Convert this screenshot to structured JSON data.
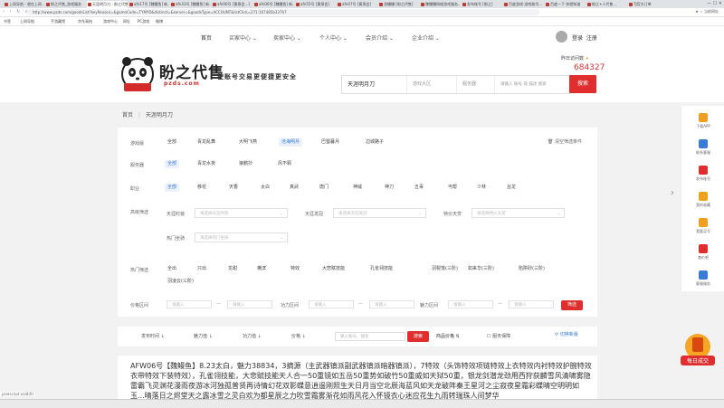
{
  "browser": {
    "tabs": [
      "上网导航 - 就在上网 ...",
      "盼之代售_游戏服务",
      "天涯明月刀 - 盼之代售",
      "afn17号 [魏鳗鱼] 新...",
      "afn33号 [魏鳗鱼] 新...",
      "afn06号 [黄泉会...]",
      "afn06号 [魏鳗鱼] 新...",
      "afn55号 [黄泉会]",
      "afn07号 [黄泉会]",
      "游鳗鳗 [盼之代售]",
      "魏鳗鳗网络游戏服务...",
      "发布账号 [盼之]",
      "百度游戏-游戏账号...",
      "百度一下 你就知道",
      "盼之+人代售...",
      "TJ官方订单"
    ],
    "url": "http://www.pzds.com/goodsList?keyReason=&gameCode=TYMYD&distinct=&server=&goodsType=ACCOUNT&listClick=271:167485b33767",
    "nav_controls": "‹ › ↻ ⌂",
    "address_right": "★ ☆ 当前网址",
    "bookmarks": [
      "书签",
      "上网导航",
      "手游藏馆",
      "京东高档",
      "游戏中心",
      "网址",
      "PC游戏",
      "微博"
    ]
  },
  "site_nav": {
    "items": [
      "首页",
      "买家中心",
      "卖家中心",
      "个人中心",
      "会员介绍",
      "企业介绍"
    ],
    "login": "登录",
    "register": "注册"
  },
  "header": {
    "logo_title": "盼之代售",
    "logo_domain": "pzds.com",
    "slogan": "使账号交易更便捷更安全",
    "visits_label": "昨日访问数",
    "visits_count": "684327",
    "search_game": "天涯明月刀",
    "search_type": "游戏大区",
    "search_server": "服务器",
    "search_placeholder": "请输入 账号 或 描述 搜索",
    "search_button": "搜索"
  },
  "breadcrumb": {
    "home": "首页",
    "sep": "|",
    "current": "天涯明月刀"
  },
  "filters": {
    "clear": "清空筛选条件",
    "game_type_label": "游戏版",
    "game_type": [
      "全部",
      "青龙乱舞",
      "大明飞燕",
      "沧海明月",
      "巴蜀暮月",
      "边城路子"
    ],
    "server_label": "服务器",
    "server": [
      "全部",
      "青龙水夜",
      "狼鹏抄",
      "风不羁"
    ],
    "class_label": "职业",
    "classes": [
      "全部",
      "移花",
      "天香",
      "太白",
      "真武",
      "唐门",
      "神威",
      "神刀",
      "五毒",
      "丐帮",
      "少林",
      "丛龙"
    ],
    "quick_label": "高级筛选",
    "selects": [
      {
        "label": "天涯时装",
        "placeholder": "请选择天涯时装"
      },
      {
        "label": "天涯发冠",
        "placeholder": "请选择天涯发冠"
      },
      {
        "label": "特价天赏",
        "placeholder": "请选择特价天赏"
      },
      {
        "label": "热门坐骑",
        "placeholder": "请选择热门坐骑"
      }
    ],
    "hot_label": "热门筛选",
    "hot_row1": [
      "全出",
      "只出",
      "龙甜",
      "横滨",
      "特效",
      "大悲赋技能",
      "孔雀翎技能",
      "羽裂落(三阶)",
      "如来华(三阶)",
      "陷阱砂(三阶)"
    ],
    "hot_row2": [
      "羽凌云(三阶)"
    ],
    "price_label": "价格区间",
    "score_label": "功力区间",
    "charm_label": "魅力区间",
    "input_placeholder": "请输入",
    "dash": "—",
    "filter_button": "筛选"
  },
  "sortbar": {
    "items": [
      "发布时间 ↓",
      "魅力值 ↓",
      "功力值 ↓",
      "价格 ↓"
    ],
    "keyword_placeholder": "输入账号、搜索",
    "search_button": "搜索",
    "product_price": "商品价格",
    "service": "服务保障",
    "switch": "切换新版"
  },
  "listing": {
    "text": "AFW06号【魏鳗鱼】8.23太白，魅力38834，3摘源（主武器镇派副武器镇派暗器镇派），7特效（头饰特效项链特效上衣特效内衬特效护腕特效衣带特效下装特效），孔雀翎技能，大悲赋技能天人合一50重镜如五岳50重势如破竹50重威如天狱50重，银龙剑潜龙劲用西狩获麟雪风清啸雾隐雷霸飞灵渊花漫雨夜游冰河独孤普贤再诗情幻花双影蝶意逍遥刚照生天日月当空北辰海蓝风如天龙破阵秦王星河之尘寂夜星霜彩蝶晴空明明如玉...晴落日之烬堂天之露冰雪之灵白欢为都星辰之力吹雪霜雾渐花如雨风花入怀镜衣心迷应花生九雨转瑞珠人间梦华"
  },
  "sidebar": {
    "items": [
      "下载APP",
      "联系客服",
      "发布账号",
      "我的收藏",
      "我要买号",
      "查价吧",
      "客服服务"
    ],
    "promo": "每日成交"
  },
  "status": {
    "text": "javascript:void(0)"
  },
  "colors": {
    "brand_red": "#e02e2e",
    "accent_blue": "#3a7bd5"
  }
}
